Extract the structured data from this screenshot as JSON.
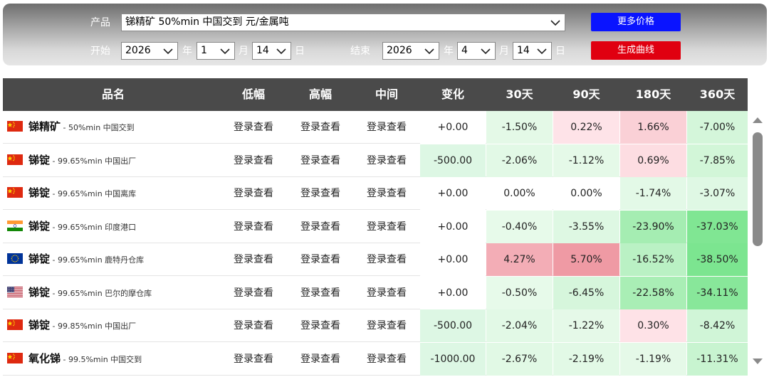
{
  "filter": {
    "product_label": "产品",
    "product_value": "锑精矿 50%min 中国交到 元/金属吨",
    "start_label": "开始",
    "start_year": "2026",
    "start_month": "1",
    "start_day": "14",
    "end_label": "结束",
    "end_year": "2026",
    "end_month": "4",
    "end_day": "14",
    "year_unit": "年",
    "month_unit": "月",
    "day_unit": "日",
    "more_prices_label": "更多价格",
    "generate_curve_label": "生成曲线"
  },
  "colors": {
    "header_bg": "#4a4a4a",
    "btn_blue": "#0a14ff",
    "btn_red": "#e00010"
  },
  "table": {
    "headers": [
      "品名",
      "低幅",
      "高幅",
      "中间",
      "变化",
      "30天",
      "90天",
      "180天",
      "360天"
    ],
    "rows": [
      {
        "flag": "china-flag-icon",
        "name": "锑精矿",
        "spec": "50%min 中国交到",
        "low": "登录查看",
        "high": "登录查看",
        "mid": "登录查看",
        "change": "+0.00",
        "d30": "-1.50%",
        "d90": "0.22%",
        "d180": "1.66%",
        "d360": "-7.00%"
      },
      {
        "flag": "china-flag-icon",
        "name": "锑锭",
        "spec": "99.65%min 中国出厂",
        "low": "登录查看",
        "high": "登录查看",
        "mid": "登录查看",
        "change": "-500.00",
        "d30": "-2.06%",
        "d90": "-1.12%",
        "d180": "0.69%",
        "d360": "-7.85%"
      },
      {
        "flag": "china-flag-icon",
        "name": "锑锭",
        "spec": "99.65%min 中国离库",
        "low": "登录查看",
        "high": "登录查看",
        "mid": "登录查看",
        "change": "+0.00",
        "d30": "0.00%",
        "d90": "0.00%",
        "d180": "-1.74%",
        "d360": "-3.07%"
      },
      {
        "flag": "india-flag-icon",
        "name": "锑锭",
        "spec": "99.65%min 印度港口",
        "low": "登录查看",
        "high": "登录查看",
        "mid": "登录查看",
        "change": "+0.00",
        "d30": "-0.40%",
        "d90": "-3.55%",
        "d180": "-23.90%",
        "d360": "-37.03%"
      },
      {
        "flag": "eu-flag-icon",
        "name": "锑锭",
        "spec": "99.65%min 鹿特丹仓库",
        "low": "登录查看",
        "high": "登录查看",
        "mid": "登录查看",
        "change": "+0.00",
        "d30": "4.27%",
        "d90": "5.70%",
        "d180": "-16.52%",
        "d360": "-38.50%"
      },
      {
        "flag": "usa-flag-icon",
        "name": "锑锭",
        "spec": "99.65%min 巴尔的摩仓库",
        "low": "登录查看",
        "high": "登录查看",
        "mid": "登录查看",
        "change": "+0.00",
        "d30": "-0.50%",
        "d90": "-6.45%",
        "d180": "-22.58%",
        "d360": "-34.11%"
      },
      {
        "flag": "china-flag-icon",
        "name": "锑锭",
        "spec": "99.85%min 中国出厂",
        "low": "登录查看",
        "high": "登录查看",
        "mid": "登录查看",
        "change": "-500.00",
        "d30": "-2.04%",
        "d90": "-1.22%",
        "d180": "0.30%",
        "d360": "-8.42%"
      },
      {
        "flag": "china-flag-icon",
        "name": "氧化锑",
        "spec": "99.5%min 中国交到",
        "low": "登录查看",
        "high": "登录查看",
        "mid": "登录查看",
        "change": "-1000.00",
        "d30": "-2.67%",
        "d90": "-2.19%",
        "d180": "-1.19%",
        "d360": "-11.31%"
      }
    ]
  }
}
